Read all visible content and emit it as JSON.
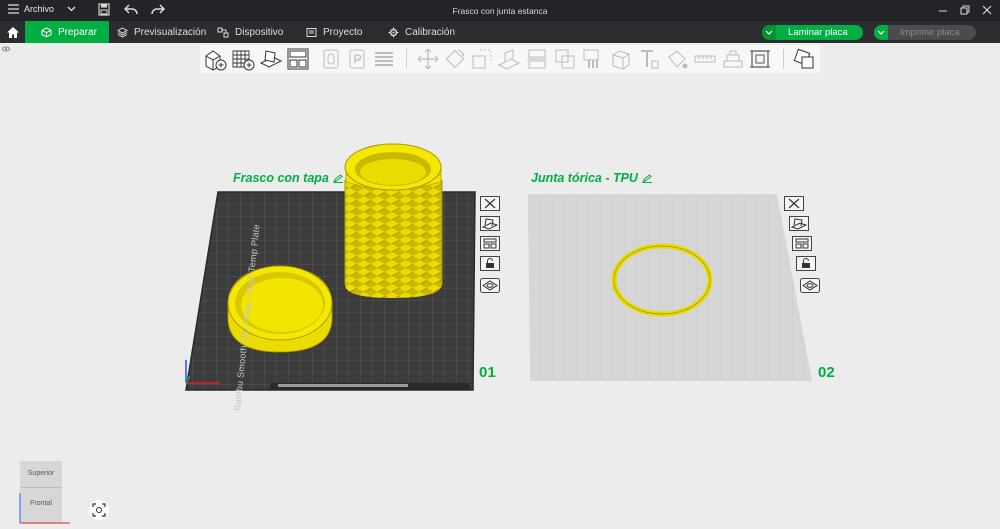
{
  "window": {
    "title": "Frasco con junta estanca"
  },
  "menu": {
    "label": "Archivo"
  },
  "nav": {
    "tabs": [
      "Preparar",
      "Previsualización",
      "Dispositivo",
      "Proyecto",
      "Calibración"
    ],
    "slice_button": "Laminar placa",
    "print_button": "Imprimir placa"
  },
  "plates": [
    {
      "name": "Frasco con tapa",
      "number": "01",
      "bed_label": "Bambu Smooth PEI Plate / High Temp Plate"
    },
    {
      "name": "Junta tórica - TPU",
      "number": "02"
    }
  ],
  "view_cube": {
    "top": "Superior",
    "front": "Frontal"
  },
  "colors": {
    "accent": "#00ae42",
    "model": "#f0e400",
    "dark_bg": "#232427",
    "bed_dark": "#3c3c3c",
    "bed_light": "#d6d6d6"
  },
  "icons": [
    "home-icon",
    "menu-icon",
    "save-icon",
    "undo-icon",
    "redo-icon",
    "minimize-icon",
    "maximize-icon",
    "close-icon",
    "add-object-icon",
    "add-plate-icon",
    "auto-orient-icon",
    "arrange-icon",
    "move-icon",
    "rotate-icon",
    "scale-icon",
    "cut-icon",
    "support-paint-icon",
    "seam-paint-icon",
    "color-paint-icon",
    "assembly-icon",
    "measure-icon"
  ]
}
